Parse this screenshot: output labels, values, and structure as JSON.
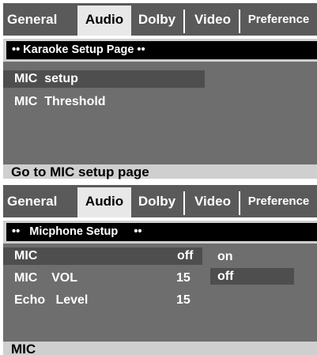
{
  "tabs": [
    "General",
    "Audio",
    "Dolby",
    "Video",
    "Preference"
  ],
  "active_tab": "Audio",
  "screen1": {
    "header": "•• Karaoke Setup Page ••",
    "items": [
      {
        "label": "MIC  setup"
      },
      {
        "label": "MIC  Threshold"
      }
    ],
    "selected_index": 0,
    "status": "Go to MIC setup page"
  },
  "screen2": {
    "header": "••   Micphone Setup     ••",
    "items": [
      {
        "label": "MIC",
        "value": "off"
      },
      {
        "label": "MIC    VOL",
        "value": "15"
      },
      {
        "label": "Echo   Level",
        "value": "15"
      }
    ],
    "selected_index": 0,
    "options": [
      "on",
      "off"
    ],
    "selected_option": "off",
    "status": "MIC"
  },
  "colors": {
    "tab_bar": "#5a5a5a",
    "active_tab": "#e8e8e8",
    "panel": "#6e6e6e",
    "highlight": "#4e4e4e",
    "header_bar": "#000000",
    "status_bar": "#cfcfcf"
  }
}
